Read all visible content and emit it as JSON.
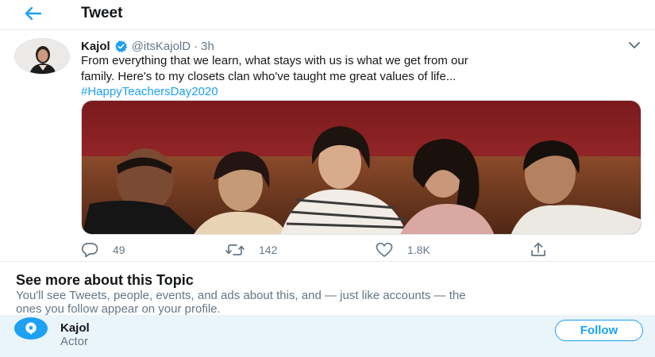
{
  "header": {
    "title": "Tweet",
    "back_icon": "arrow-left-icon"
  },
  "tweet": {
    "author_name": "Kajol",
    "handle": "@itsKajolD",
    "separator": "·",
    "time": "3h",
    "text_line1": "From everything that we learn, what stays with us is what we get from our",
    "text_line2": "family. Here's to my closets clan who've taught me great values of life...",
    "hashtag": "#HappyTeachersDay2020",
    "media_description_icon": "photo",
    "actions": {
      "reply_count": "49",
      "retweet_count": "142",
      "like_count": "1.8K"
    }
  },
  "topic": {
    "title": "See more about this Topic",
    "desc_line1": "You'll see Tweets, people, events, and ads about this, and — just like accounts — the",
    "desc_line2": "ones you follow appear on your profile.",
    "card": {
      "name": "Kajol",
      "subtitle": "Actor",
      "follow_label": "Follow",
      "icon": "topic-bubble-icon"
    }
  },
  "colors": {
    "accent": "#1da1f2",
    "text_secondary": "#657786",
    "topic_card_bg": "#eaf4fb"
  }
}
